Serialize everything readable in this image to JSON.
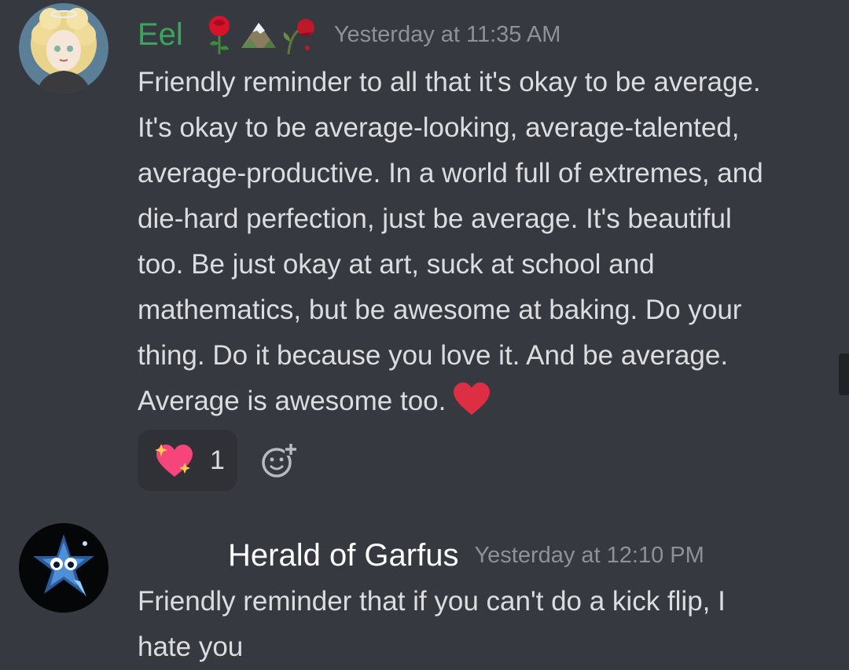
{
  "messages": [
    {
      "username": "Eel",
      "timestamp": "Yesterday at 11:35 AM",
      "badges": [
        "rose-icon",
        "mountain-icon",
        "wilted-rose-icon"
      ],
      "content": "Friendly reminder to all that it's okay to be average.\nIt's okay to be average-looking, average-talented,\naverage-productive. In a world full of extremes, and\ndie-hard perfection, just be average. It's beautiful\ntoo. Be just okay at art, suck at school and\nmathematics, but be awesome at baking. Do your\nthing. Do it because you love it. And be average.\nAverage is awesome too.",
      "trailing_emoji": "red-heart-icon",
      "reactions": [
        {
          "emoji": "sparkling-heart-icon",
          "count": "1"
        }
      ]
    },
    {
      "username": "Herald of Garfus",
      "timestamp": "Yesterday at 12:10 PM",
      "content": "Friendly reminder that if you can't do a kick flip, I\nhate you"
    }
  ],
  "colors": {
    "background": "#36393f",
    "username_1": "#3ba55d",
    "username_2": "#ffffff",
    "timestamp": "#8e9297",
    "text": "#dcddde",
    "reaction_bg": "#2f3136"
  }
}
